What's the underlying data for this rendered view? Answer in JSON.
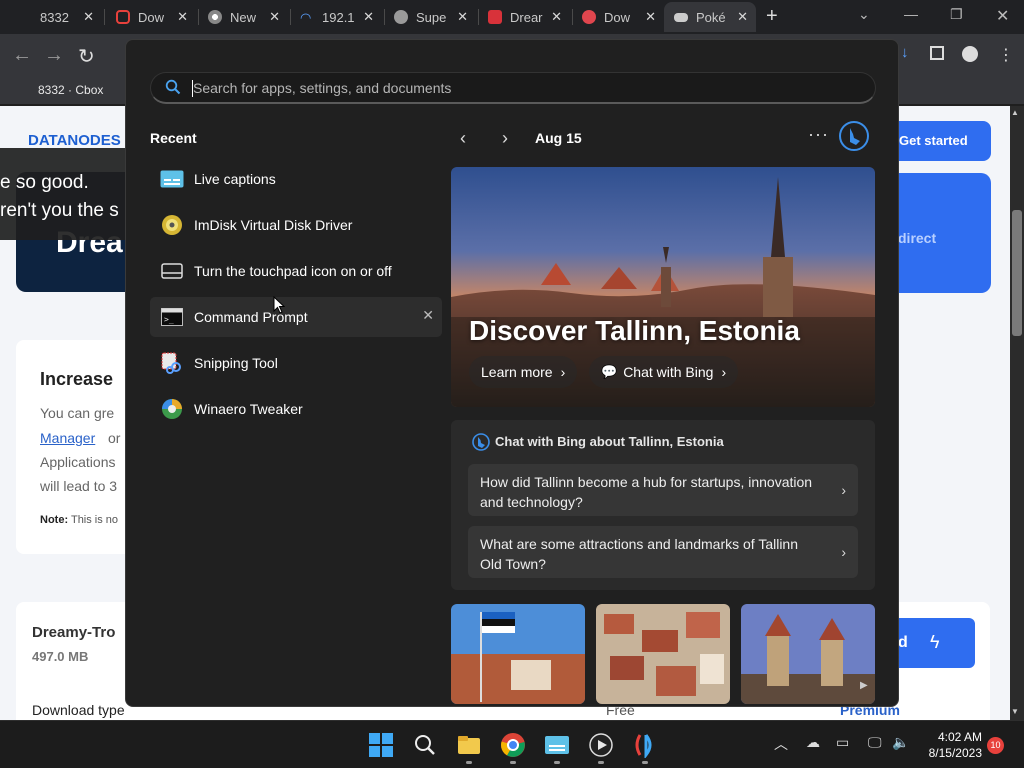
{
  "browser": {
    "tabs": [
      {
        "title": "8332"
      },
      {
        "title": "Dow"
      },
      {
        "title": "New"
      },
      {
        "title": "192.1"
      },
      {
        "title": "Supe"
      },
      {
        "title": "Drear"
      },
      {
        "title": "Dow"
      },
      {
        "title": "Poké"
      }
    ],
    "bookmark": "8332 · Cbox"
  },
  "webpage": {
    "logo": "DATANODES",
    "hero_title": "Drea",
    "get_started": "Get started",
    "blue_panel_text": "direct",
    "caption_line1": "e so good.",
    "caption_line2": "ren't you the s",
    "increase_heading": "Increase",
    "line1": "You can gre",
    "manager_link": "Manager",
    "or_text": "or",
    "line3": "Applications",
    "line4": "will lead to 3",
    "note_label": "Note:",
    "note_text": "This is no",
    "file_name": "Dreamy-Tro",
    "file_size": "497.0 MB",
    "download_btn": "d",
    "download_type": "Download type",
    "free": "Free",
    "premium": "Premium"
  },
  "startmenu": {
    "search_placeholder": "Search for apps, settings, and documents",
    "recent_heading": "Recent",
    "recent_items": [
      {
        "label": "Live captions",
        "icon": "live-captions-icon"
      },
      {
        "label": "ImDisk Virtual Disk Driver",
        "icon": "imdisk-icon"
      },
      {
        "label": "Turn the touchpad icon on or off",
        "icon": "touchpad-icon"
      },
      {
        "label": "Command Prompt",
        "icon": "command-prompt-icon"
      },
      {
        "label": "Snipping Tool",
        "icon": "snipping-tool-icon"
      },
      {
        "label": "Winaero Tweaker",
        "icon": "winaero-tweaker-icon"
      }
    ],
    "date": "Aug 15",
    "hero_title": "Discover Tallinn, Estonia",
    "learn_more": "Learn more",
    "chat_with_bing": "Chat with Bing",
    "chat_heading": "Chat with Bing about Tallinn, Estonia",
    "questions": [
      "How did Tallinn become a hub for startups, innovation and technology?",
      "What are some attractions and landmarks of Tallinn Old Town?"
    ]
  },
  "taskbar": {
    "time": "4:02 AM",
    "date": "8/15/2023",
    "notification_count": "10"
  },
  "colors": {
    "accent": "#3b8ee8",
    "panel_bg": "#202020",
    "brand_blue": "#2f6df0"
  }
}
